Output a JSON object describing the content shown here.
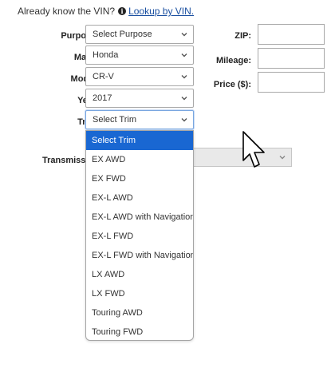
{
  "vin_prompt": {
    "text": "Already know the VIN?",
    "link": "Lookup by VIN."
  },
  "form": {
    "purpose": {
      "label": "Purpose:",
      "value": "Select Purpose"
    },
    "make": {
      "label": "Make:",
      "value": "Honda"
    },
    "model": {
      "label": "Model:",
      "value": "CR-V"
    },
    "year": {
      "label": "Year:",
      "value": "2017"
    },
    "trim": {
      "label": "Trim:",
      "value": "Select Trim",
      "options": [
        "Select Trim",
        "EX AWD",
        "EX FWD",
        "EX-L AWD",
        "EX-L AWD with Navigation",
        "EX-L FWD",
        "EX-L FWD with Navigation",
        "LX AWD",
        "LX FWD",
        "Touring AWD",
        "Touring FWD"
      ],
      "highlighted_option": "Select Trim"
    },
    "transmission": {
      "label": "Transmission:"
    },
    "zip": {
      "label": "ZIP:",
      "value": ""
    },
    "mileage": {
      "label": "Mileage:",
      "value": ""
    },
    "price": {
      "label": "Price ($):",
      "value": ""
    }
  },
  "colors": {
    "link": "#1a4fa0",
    "highlight": "#1967d2"
  }
}
